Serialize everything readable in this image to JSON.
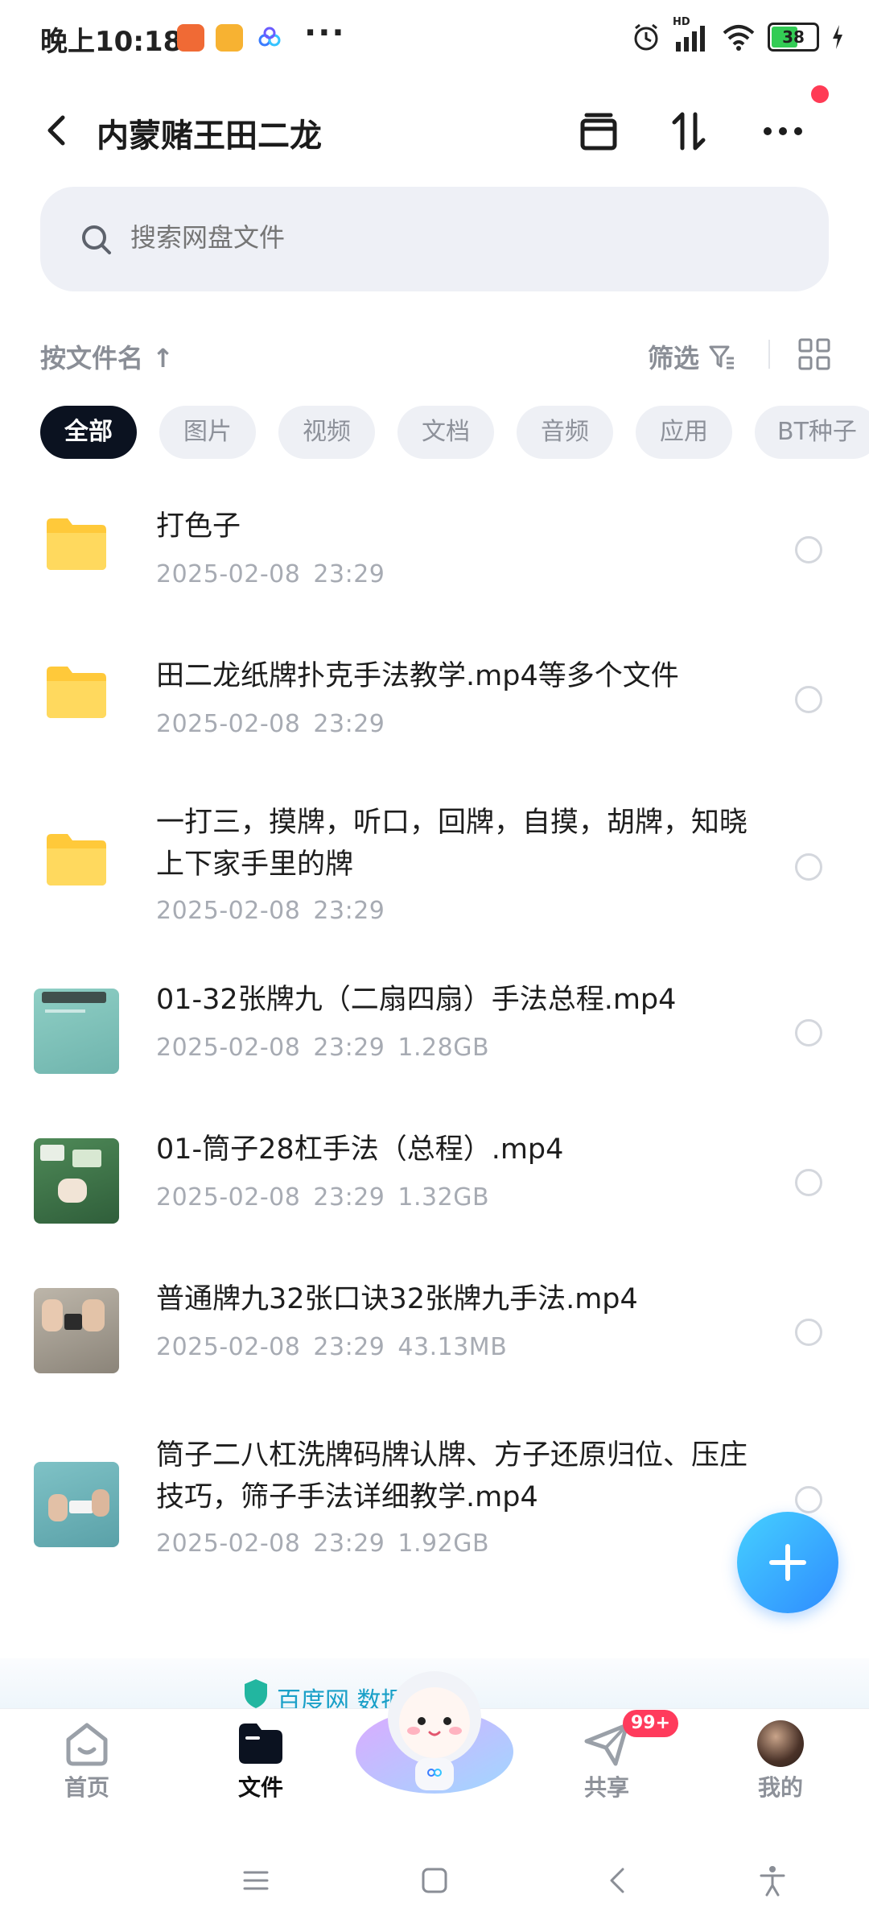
{
  "status_bar": {
    "time": "晚上10:18",
    "more_dots": "···",
    "battery": "38",
    "battery_color": "#33cc55",
    "network_label": "HD"
  },
  "header": {
    "title": "内蒙赌王田二龙",
    "icons": [
      "back-icon",
      "archive-icon",
      "sort-icon",
      "more-icon"
    ]
  },
  "search": {
    "placeholder": "搜索网盘文件"
  },
  "sort_bar": {
    "sort_label": "按文件名 ↑",
    "filter_label": "筛选"
  },
  "filter_chips": [
    {
      "label": "全部",
      "active": true
    },
    {
      "label": "图片",
      "active": false
    },
    {
      "label": "视频",
      "active": false
    },
    {
      "label": "文档",
      "active": false
    },
    {
      "label": "音频",
      "active": false
    },
    {
      "label": "应用",
      "active": false
    },
    {
      "label": "BT种子",
      "active": false
    }
  ],
  "files": [
    {
      "name": "打色子",
      "date": "2025-02-08",
      "time": "23:29",
      "size": "",
      "kind": "folder"
    },
    {
      "name": "田二龙纸牌扑克手法教学.mp4等多个文件",
      "date": "2025-02-08",
      "time": "23:29",
      "size": "",
      "kind": "folder"
    },
    {
      "name": "一打三，摸牌，听口，回牌，自摸，胡牌，知晓上下家手里的牌",
      "date": "2025-02-08",
      "time": "23:29",
      "size": "",
      "kind": "folder"
    },
    {
      "name": "01-32张牌九（二扇四扇）手法总程.mp4",
      "date": "2025-02-08",
      "time": "23:29",
      "size": "1.28GB",
      "kind": "video"
    },
    {
      "name": "01-筒子28杠手法（总程）.mp4",
      "date": "2025-02-08",
      "time": "23:29",
      "size": "1.32GB",
      "kind": "video"
    },
    {
      "name": "普通牌九32张口诀32张牌九手法.mp4",
      "date": "2025-02-08",
      "time": "23:29",
      "size": "43.13MB",
      "kind": "video"
    },
    {
      "name": "筒子二八杠洗牌码牌认牌、方子还原归位、压庄技巧，筛子手法详细教学.mp4",
      "date": "2025-02-08",
      "time": "23:29",
      "size": "1.92GB",
      "kind": "video"
    }
  ],
  "banner": {
    "text": "百度网    数据安全 〉"
  },
  "bottom_nav": [
    {
      "label": "首页",
      "icon": "home-icon",
      "active": false
    },
    {
      "label": "文件",
      "icon": "folder-icon",
      "active": true
    },
    {
      "label": "",
      "icon": "assistant-mascot",
      "active": false
    },
    {
      "label": "共享",
      "icon": "share-icon",
      "active": false,
      "badge": "99+"
    },
    {
      "label": "我的",
      "icon": "avatar",
      "active": false
    }
  ],
  "system_nav": [
    "menu-icon",
    "home-square-icon",
    "back-chevron-icon",
    "accessibility-icon"
  ],
  "colors": {
    "accent": "#2f8cff",
    "active_chip": "#0b1220",
    "folder": "#ffc93a",
    "badge": "#ff3b5c"
  }
}
